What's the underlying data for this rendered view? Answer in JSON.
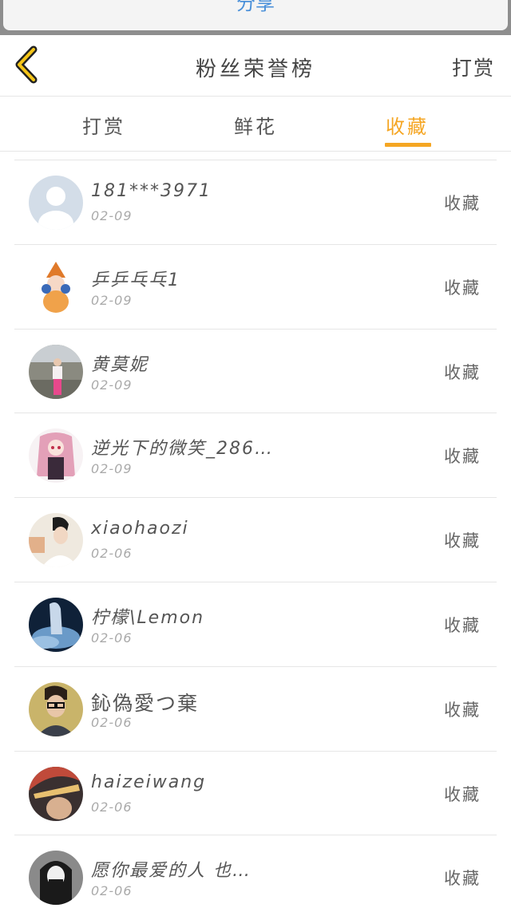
{
  "top": {
    "share_label": "分享"
  },
  "nav": {
    "title": "粉丝荣誉榜",
    "reward_link": "打赏"
  },
  "tabs": [
    {
      "label": "打赏"
    },
    {
      "label": "鲜花"
    },
    {
      "label": "收藏"
    }
  ],
  "active_tab_color": "#f5a623",
  "rows": [
    {
      "name": "181***3971",
      "date": "02-09",
      "action": "收藏"
    },
    {
      "name": "乒乒乓乓1",
      "date": "02-09",
      "action": "收藏"
    },
    {
      "name": "黄莫妮",
      "date": "02-09",
      "action": "收藏"
    },
    {
      "name": "逆光下的微笑_286…",
      "date": "02-09",
      "action": "收藏"
    },
    {
      "name": "xiaohaozi",
      "date": "02-06",
      "action": "收藏"
    },
    {
      "name": "柠檬\\Lemon",
      "date": "02-06",
      "action": "收藏"
    },
    {
      "name": "鈊偽愛つ棄",
      "date": "02-06",
      "action": "收藏"
    },
    {
      "name": "haizeiwang",
      "date": "02-06",
      "action": "收藏"
    },
    {
      "name": "愿你最爱的人 也…",
      "date": "02-06",
      "action": "收藏"
    }
  ]
}
